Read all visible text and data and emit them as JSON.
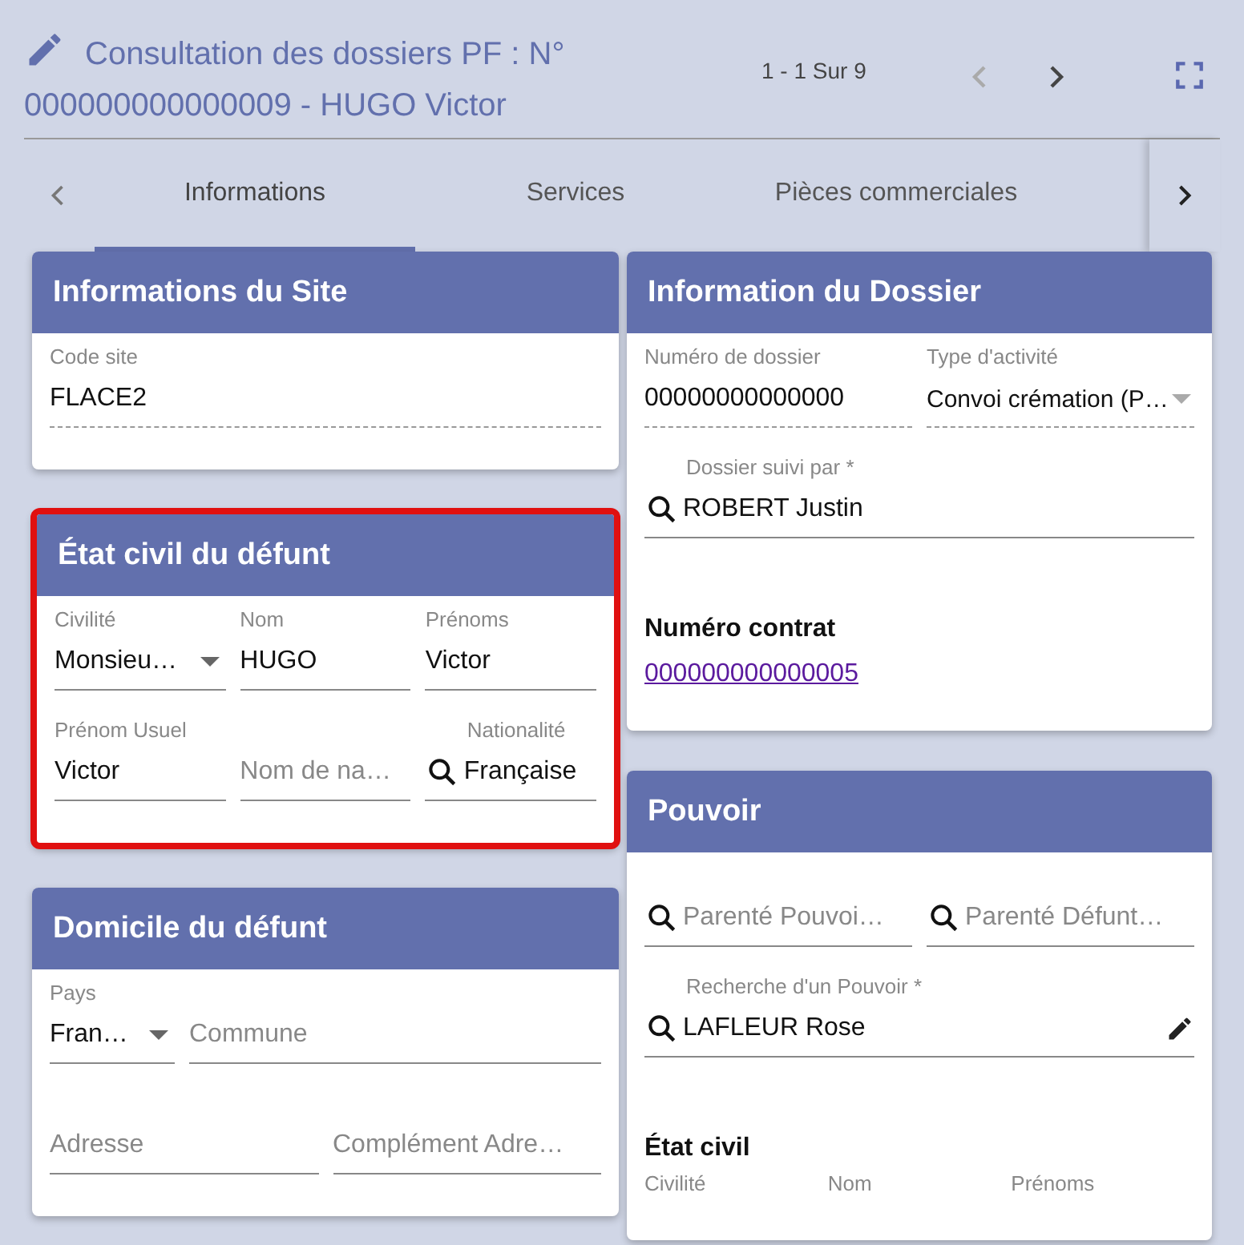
{
  "header": {
    "title_lines": [
      "Consultation des dossiers PF : N°",
      "000000000000009 - HUGO Victor"
    ],
    "record_count": "1 - 1 Sur 9"
  },
  "tabs": [
    {
      "label": "Informations",
      "selected": true
    },
    {
      "label": "Services",
      "selected": false
    },
    {
      "label": "Pièces commerciales",
      "selected": false
    }
  ],
  "left_cards": [
    {
      "title": "Informations du Site",
      "highlighted": false,
      "rows": [
        [
          {
            "kind": "readonly",
            "label": "Code site",
            "value": "FLACE2"
          }
        ]
      ]
    },
    {
      "title": "État civil du défunt",
      "highlighted": true,
      "rows": [
        [
          {
            "kind": "select",
            "label": "Civilité",
            "value": "Monsieu…"
          },
          {
            "kind": "input",
            "label": "Nom",
            "value": "HUGO"
          },
          {
            "kind": "input",
            "label": "Prénoms",
            "value": "Victor"
          }
        ],
        [
          {
            "kind": "input",
            "label": "Prénom Usuel",
            "value": "Victor"
          },
          {
            "kind": "input",
            "placeholder": "Nom de na…"
          },
          {
            "kind": "search",
            "label": "Nationalité",
            "value": "Française"
          }
        ]
      ]
    },
    {
      "title": "Domicile du défunt",
      "highlighted": false,
      "rows": [
        [
          {
            "kind": "select",
            "label": "Pays",
            "value": "Fran…"
          },
          {
            "kind": "input",
            "placeholder": "Commune"
          }
        ],
        [
          {
            "kind": "input",
            "placeholder": "Adresse"
          },
          {
            "kind": "input",
            "placeholder": "Complément Adre…"
          }
        ]
      ]
    }
  ],
  "right_cards": [
    {
      "title": "Information du Dossier",
      "highlighted": false,
      "rows": [
        [
          {
            "kind": "readonly",
            "label": "Numéro de dossier",
            "value": "00000000000000"
          },
          {
            "kind": "readonly_select",
            "label": "Type d'activité",
            "value": "Convoi crémation (P…"
          }
        ],
        [
          {
            "kind": "search",
            "label": "Dossier suivi par *",
            "value": "ROBERT Justin"
          }
        ],
        [
          {
            "kind": "link",
            "label": "Numéro contrat",
            "value": "000000000000005"
          }
        ]
      ]
    },
    {
      "title": "Pouvoir",
      "highlighted": false,
      "rows": [
        [
          {
            "kind": "search",
            "placeholder": "Parenté Pouvoi…"
          },
          {
            "kind": "search",
            "placeholder": "Parenté Défunt…"
          }
        ],
        [
          {
            "kind": "search_edit",
            "label": "Recherche d'un Pouvoir *",
            "value": "LAFLEUR  Rose"
          }
        ]
      ],
      "section": {
        "title": "État civil",
        "labels": [
          "Civilité",
          "Nom",
          "Prénoms"
        ]
      }
    }
  ]
}
